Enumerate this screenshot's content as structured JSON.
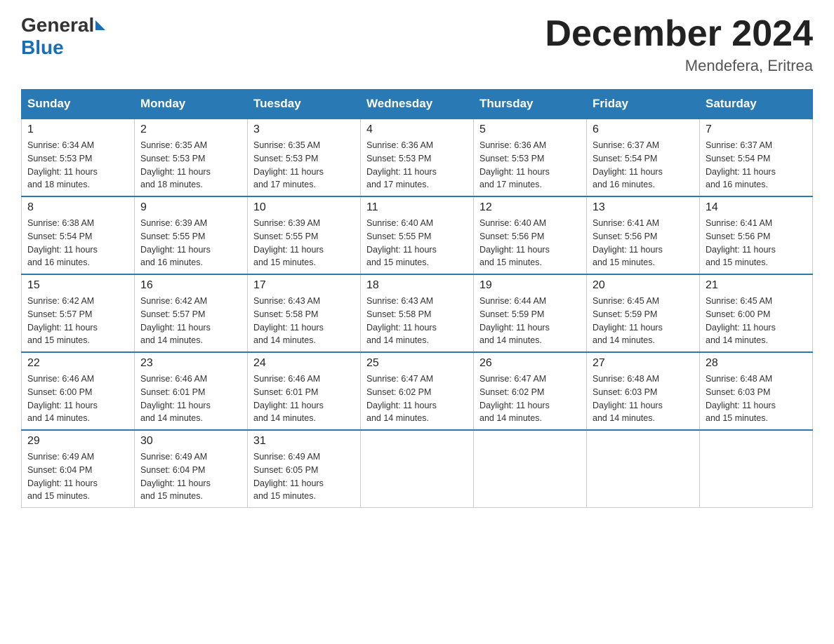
{
  "header": {
    "logo_general": "General",
    "logo_blue": "Blue",
    "month_title": "December 2024",
    "location": "Mendefera, Eritrea"
  },
  "days_of_week": [
    "Sunday",
    "Monday",
    "Tuesday",
    "Wednesday",
    "Thursday",
    "Friday",
    "Saturday"
  ],
  "weeks": [
    [
      {
        "day": "1",
        "sunrise": "6:34 AM",
        "sunset": "5:53 PM",
        "daylight": "11 hours and 18 minutes."
      },
      {
        "day": "2",
        "sunrise": "6:35 AM",
        "sunset": "5:53 PM",
        "daylight": "11 hours and 18 minutes."
      },
      {
        "day": "3",
        "sunrise": "6:35 AM",
        "sunset": "5:53 PM",
        "daylight": "11 hours and 17 minutes."
      },
      {
        "day": "4",
        "sunrise": "6:36 AM",
        "sunset": "5:53 PM",
        "daylight": "11 hours and 17 minutes."
      },
      {
        "day": "5",
        "sunrise": "6:36 AM",
        "sunset": "5:53 PM",
        "daylight": "11 hours and 17 minutes."
      },
      {
        "day": "6",
        "sunrise": "6:37 AM",
        "sunset": "5:54 PM",
        "daylight": "11 hours and 16 minutes."
      },
      {
        "day": "7",
        "sunrise": "6:37 AM",
        "sunset": "5:54 PM",
        "daylight": "11 hours and 16 minutes."
      }
    ],
    [
      {
        "day": "8",
        "sunrise": "6:38 AM",
        "sunset": "5:54 PM",
        "daylight": "11 hours and 16 minutes."
      },
      {
        "day": "9",
        "sunrise": "6:39 AM",
        "sunset": "5:55 PM",
        "daylight": "11 hours and 16 minutes."
      },
      {
        "day": "10",
        "sunrise": "6:39 AM",
        "sunset": "5:55 PM",
        "daylight": "11 hours and 15 minutes."
      },
      {
        "day": "11",
        "sunrise": "6:40 AM",
        "sunset": "5:55 PM",
        "daylight": "11 hours and 15 minutes."
      },
      {
        "day": "12",
        "sunrise": "6:40 AM",
        "sunset": "5:56 PM",
        "daylight": "11 hours and 15 minutes."
      },
      {
        "day": "13",
        "sunrise": "6:41 AM",
        "sunset": "5:56 PM",
        "daylight": "11 hours and 15 minutes."
      },
      {
        "day": "14",
        "sunrise": "6:41 AM",
        "sunset": "5:56 PM",
        "daylight": "11 hours and 15 minutes."
      }
    ],
    [
      {
        "day": "15",
        "sunrise": "6:42 AM",
        "sunset": "5:57 PM",
        "daylight": "11 hours and 15 minutes."
      },
      {
        "day": "16",
        "sunrise": "6:42 AM",
        "sunset": "5:57 PM",
        "daylight": "11 hours and 14 minutes."
      },
      {
        "day": "17",
        "sunrise": "6:43 AM",
        "sunset": "5:58 PM",
        "daylight": "11 hours and 14 minutes."
      },
      {
        "day": "18",
        "sunrise": "6:43 AM",
        "sunset": "5:58 PM",
        "daylight": "11 hours and 14 minutes."
      },
      {
        "day": "19",
        "sunrise": "6:44 AM",
        "sunset": "5:59 PM",
        "daylight": "11 hours and 14 minutes."
      },
      {
        "day": "20",
        "sunrise": "6:45 AM",
        "sunset": "5:59 PM",
        "daylight": "11 hours and 14 minutes."
      },
      {
        "day": "21",
        "sunrise": "6:45 AM",
        "sunset": "6:00 PM",
        "daylight": "11 hours and 14 minutes."
      }
    ],
    [
      {
        "day": "22",
        "sunrise": "6:46 AM",
        "sunset": "6:00 PM",
        "daylight": "11 hours and 14 minutes."
      },
      {
        "day": "23",
        "sunrise": "6:46 AM",
        "sunset": "6:01 PM",
        "daylight": "11 hours and 14 minutes."
      },
      {
        "day": "24",
        "sunrise": "6:46 AM",
        "sunset": "6:01 PM",
        "daylight": "11 hours and 14 minutes."
      },
      {
        "day": "25",
        "sunrise": "6:47 AM",
        "sunset": "6:02 PM",
        "daylight": "11 hours and 14 minutes."
      },
      {
        "day": "26",
        "sunrise": "6:47 AM",
        "sunset": "6:02 PM",
        "daylight": "11 hours and 14 minutes."
      },
      {
        "day": "27",
        "sunrise": "6:48 AM",
        "sunset": "6:03 PM",
        "daylight": "11 hours and 14 minutes."
      },
      {
        "day": "28",
        "sunrise": "6:48 AM",
        "sunset": "6:03 PM",
        "daylight": "11 hours and 15 minutes."
      }
    ],
    [
      {
        "day": "29",
        "sunrise": "6:49 AM",
        "sunset": "6:04 PM",
        "daylight": "11 hours and 15 minutes."
      },
      {
        "day": "30",
        "sunrise": "6:49 AM",
        "sunset": "6:04 PM",
        "daylight": "11 hours and 15 minutes."
      },
      {
        "day": "31",
        "sunrise": "6:49 AM",
        "sunset": "6:05 PM",
        "daylight": "11 hours and 15 minutes."
      },
      null,
      null,
      null,
      null
    ]
  ],
  "labels": {
    "sunrise": "Sunrise:",
    "sunset": "Sunset:",
    "daylight": "Daylight:"
  }
}
